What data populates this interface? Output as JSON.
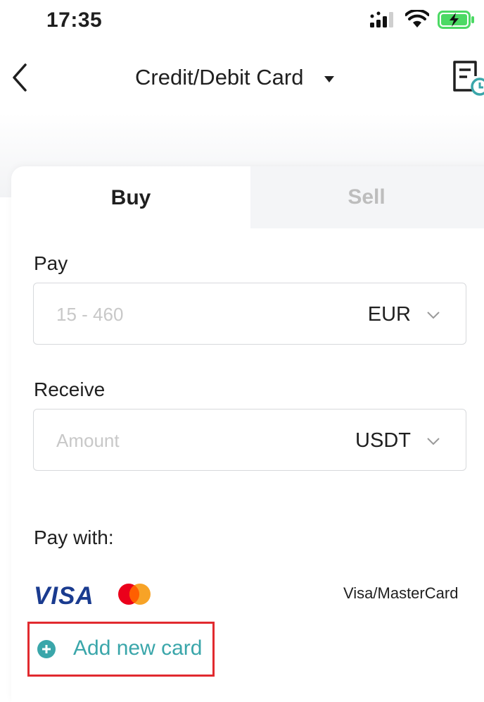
{
  "status_bar": {
    "time": "17:35",
    "icons": [
      "signal-icon",
      "wifi-icon",
      "battery-charging-icon"
    ],
    "battery_color": "#4cd964"
  },
  "nav": {
    "title": "Credit/Debit Card",
    "icons": [
      "back-chevron-icon",
      "caret-down-icon",
      "order-history-icon"
    ]
  },
  "tabs": [
    {
      "label": "Buy",
      "active": true
    },
    {
      "label": "Sell",
      "active": false
    }
  ],
  "pay": {
    "label": "Pay",
    "placeholder": "15 - 460",
    "currency": "EUR"
  },
  "receive": {
    "label": "Receive",
    "placeholder": "Amount",
    "currency": "USDT"
  },
  "pay_with": {
    "label": "Pay with:",
    "brand_text": "VISA",
    "method_label": "Visa/MasterCard"
  },
  "add_card": {
    "label": "Add new card",
    "accent_color": "#3aa6aa",
    "highlight_color": "#e12a2f"
  }
}
